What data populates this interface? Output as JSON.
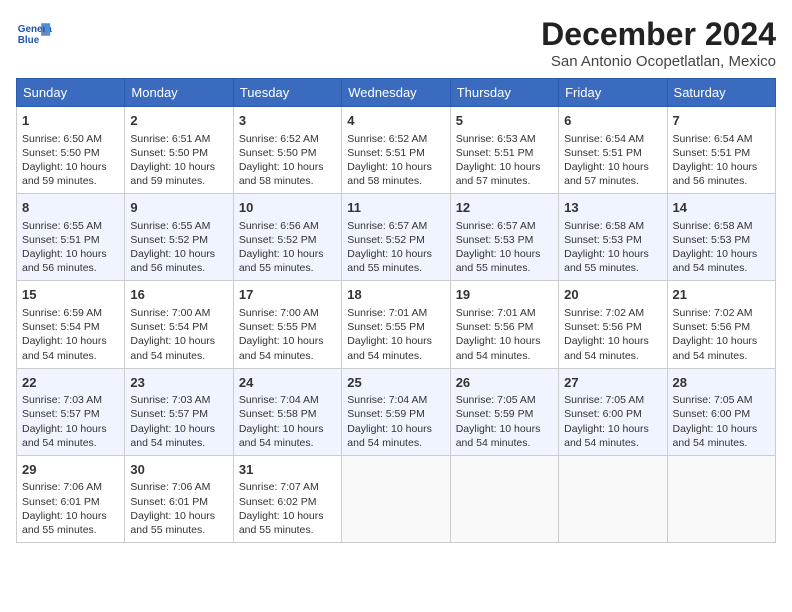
{
  "header": {
    "logo_line1": "General",
    "logo_line2": "Blue",
    "title": "December 2024",
    "subtitle": "San Antonio Ocopetlatlan, Mexico"
  },
  "weekdays": [
    "Sunday",
    "Monday",
    "Tuesday",
    "Wednesday",
    "Thursday",
    "Friday",
    "Saturday"
  ],
  "weeks": [
    [
      {
        "day": "1",
        "info": "Sunrise: 6:50 AM\nSunset: 5:50 PM\nDaylight: 10 hours\nand 59 minutes."
      },
      {
        "day": "2",
        "info": "Sunrise: 6:51 AM\nSunset: 5:50 PM\nDaylight: 10 hours\nand 59 minutes."
      },
      {
        "day": "3",
        "info": "Sunrise: 6:52 AM\nSunset: 5:50 PM\nDaylight: 10 hours\nand 58 minutes."
      },
      {
        "day": "4",
        "info": "Sunrise: 6:52 AM\nSunset: 5:51 PM\nDaylight: 10 hours\nand 58 minutes."
      },
      {
        "day": "5",
        "info": "Sunrise: 6:53 AM\nSunset: 5:51 PM\nDaylight: 10 hours\nand 57 minutes."
      },
      {
        "day": "6",
        "info": "Sunrise: 6:54 AM\nSunset: 5:51 PM\nDaylight: 10 hours\nand 57 minutes."
      },
      {
        "day": "7",
        "info": "Sunrise: 6:54 AM\nSunset: 5:51 PM\nDaylight: 10 hours\nand 56 minutes."
      }
    ],
    [
      {
        "day": "8",
        "info": "Sunrise: 6:55 AM\nSunset: 5:51 PM\nDaylight: 10 hours\nand 56 minutes."
      },
      {
        "day": "9",
        "info": "Sunrise: 6:55 AM\nSunset: 5:52 PM\nDaylight: 10 hours\nand 56 minutes."
      },
      {
        "day": "10",
        "info": "Sunrise: 6:56 AM\nSunset: 5:52 PM\nDaylight: 10 hours\nand 55 minutes."
      },
      {
        "day": "11",
        "info": "Sunrise: 6:57 AM\nSunset: 5:52 PM\nDaylight: 10 hours\nand 55 minutes."
      },
      {
        "day": "12",
        "info": "Sunrise: 6:57 AM\nSunset: 5:53 PM\nDaylight: 10 hours\nand 55 minutes."
      },
      {
        "day": "13",
        "info": "Sunrise: 6:58 AM\nSunset: 5:53 PM\nDaylight: 10 hours\nand 55 minutes."
      },
      {
        "day": "14",
        "info": "Sunrise: 6:58 AM\nSunset: 5:53 PM\nDaylight: 10 hours\nand 54 minutes."
      }
    ],
    [
      {
        "day": "15",
        "info": "Sunrise: 6:59 AM\nSunset: 5:54 PM\nDaylight: 10 hours\nand 54 minutes."
      },
      {
        "day": "16",
        "info": "Sunrise: 7:00 AM\nSunset: 5:54 PM\nDaylight: 10 hours\nand 54 minutes."
      },
      {
        "day": "17",
        "info": "Sunrise: 7:00 AM\nSunset: 5:55 PM\nDaylight: 10 hours\nand 54 minutes."
      },
      {
        "day": "18",
        "info": "Sunrise: 7:01 AM\nSunset: 5:55 PM\nDaylight: 10 hours\nand 54 minutes."
      },
      {
        "day": "19",
        "info": "Sunrise: 7:01 AM\nSunset: 5:56 PM\nDaylight: 10 hours\nand 54 minutes."
      },
      {
        "day": "20",
        "info": "Sunrise: 7:02 AM\nSunset: 5:56 PM\nDaylight: 10 hours\nand 54 minutes."
      },
      {
        "day": "21",
        "info": "Sunrise: 7:02 AM\nSunset: 5:56 PM\nDaylight: 10 hours\nand 54 minutes."
      }
    ],
    [
      {
        "day": "22",
        "info": "Sunrise: 7:03 AM\nSunset: 5:57 PM\nDaylight: 10 hours\nand 54 minutes."
      },
      {
        "day": "23",
        "info": "Sunrise: 7:03 AM\nSunset: 5:57 PM\nDaylight: 10 hours\nand 54 minutes."
      },
      {
        "day": "24",
        "info": "Sunrise: 7:04 AM\nSunset: 5:58 PM\nDaylight: 10 hours\nand 54 minutes."
      },
      {
        "day": "25",
        "info": "Sunrise: 7:04 AM\nSunset: 5:59 PM\nDaylight: 10 hours\nand 54 minutes."
      },
      {
        "day": "26",
        "info": "Sunrise: 7:05 AM\nSunset: 5:59 PM\nDaylight: 10 hours\nand 54 minutes."
      },
      {
        "day": "27",
        "info": "Sunrise: 7:05 AM\nSunset: 6:00 PM\nDaylight: 10 hours\nand 54 minutes."
      },
      {
        "day": "28",
        "info": "Sunrise: 7:05 AM\nSunset: 6:00 PM\nDaylight: 10 hours\nand 54 minutes."
      }
    ],
    [
      {
        "day": "29",
        "info": "Sunrise: 7:06 AM\nSunset: 6:01 PM\nDaylight: 10 hours\nand 55 minutes."
      },
      {
        "day": "30",
        "info": "Sunrise: 7:06 AM\nSunset: 6:01 PM\nDaylight: 10 hours\nand 55 minutes."
      },
      {
        "day": "31",
        "info": "Sunrise: 7:07 AM\nSunset: 6:02 PM\nDaylight: 10 hours\nand 55 minutes."
      },
      null,
      null,
      null,
      null
    ]
  ]
}
